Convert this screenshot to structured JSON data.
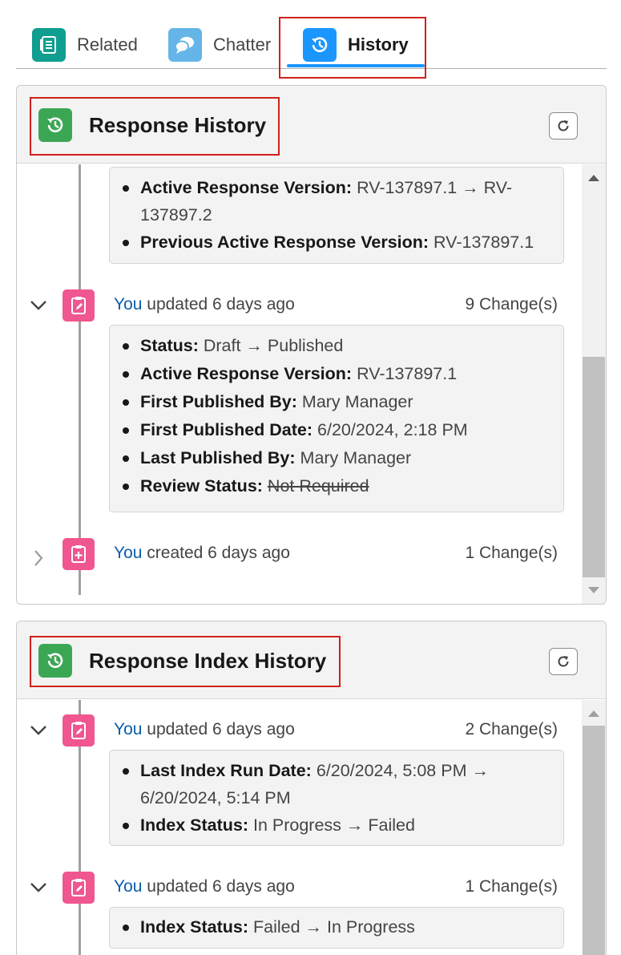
{
  "tabs": [
    {
      "label": "Related",
      "icon": "related-list-icon",
      "color": "#0f9e8f"
    },
    {
      "label": "Chatter",
      "icon": "chatter-icon",
      "color": "#66b5e8"
    },
    {
      "label": "History",
      "icon": "history-icon",
      "color": "#1b96ff",
      "active": true
    }
  ],
  "cards": {
    "response_history": {
      "title": "Response History",
      "partial_entry": {
        "changes": [
          {
            "field": "Active Response Version:",
            "value": "RV-137897.1 → RV-137897.2"
          },
          {
            "field": "Previous Active Response Version:",
            "value": "RV-137897.1"
          }
        ]
      },
      "entries": [
        {
          "who": "You",
          "action": " updated 6 days ago",
          "count": "9 Change(s)",
          "expanded": true,
          "changes": [
            {
              "field": "Status:",
              "value": "Draft → Published"
            },
            {
              "field": "Active Response Version:",
              "value": "RV-137897.1"
            },
            {
              "field": "First Published By:",
              "value": "Mary Manager"
            },
            {
              "field": "First Published Date:",
              "value": "6/20/2024, 2:18 PM"
            },
            {
              "field": "Last Published By:",
              "value": "Mary Manager"
            },
            {
              "field": "Review Status:",
              "value": "Not Required",
              "struck": true
            }
          ]
        },
        {
          "who": "You",
          "action": " created 6 days ago",
          "count": "1 Change(s)",
          "expanded": false
        }
      ]
    },
    "response_index_history": {
      "title": "Response Index History",
      "entries": [
        {
          "who": "You",
          "action": " updated 6 days ago",
          "count": "2 Change(s)",
          "expanded": true,
          "changes": [
            {
              "field": "Last Index Run Date:",
              "value": "6/20/2024, 5:08 PM → 6/20/2024, 5:14 PM"
            },
            {
              "field": "Index Status:",
              "value": "In Progress → Failed"
            }
          ]
        },
        {
          "who": "You",
          "action": " updated 6 days ago",
          "count": "1 Change(s)",
          "expanded": true,
          "changes": [
            {
              "field": "Index Status:",
              "value": "Failed → In Progress"
            }
          ]
        }
      ]
    }
  },
  "colors": {
    "accent": "#1b96ff",
    "history_icon_bg": "#3ba755",
    "entry_icon_bg": "#f0568f",
    "highlight_box": "#d0211c",
    "link": "#0b5cab"
  }
}
